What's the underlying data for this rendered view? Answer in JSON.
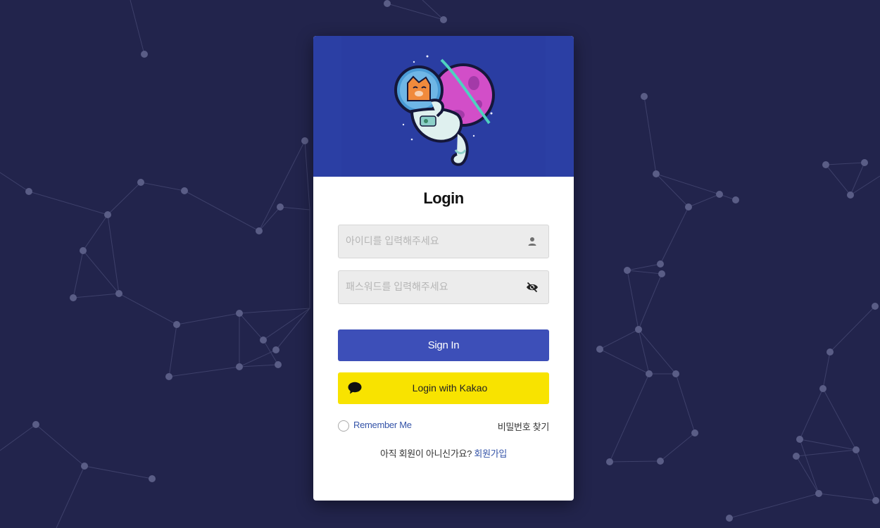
{
  "login": {
    "title": "Login",
    "id_placeholder": "아이디를 입력해주세요",
    "password_placeholder": "패스워드를 입력해주세요",
    "signin_label": "Sign In",
    "kakao_label": "Login with Kakao",
    "remember_label": "Remember Me",
    "find_password_label": "비밀번호 찾기",
    "signup_prompt": "아직 회원이 아니신가요?",
    "signup_link": "회원가입"
  },
  "icons": {
    "user": "user-icon",
    "eye_off": "eye-off-icon",
    "kakao_chat": "chat-bubble-icon",
    "logo": "astronaut-cat-planet-logo"
  },
  "colors": {
    "background": "#22244c",
    "header": "#2b3fa4",
    "signin_button": "#3d4fb8",
    "kakao_button": "#f8e300",
    "link": "#3554a8"
  }
}
